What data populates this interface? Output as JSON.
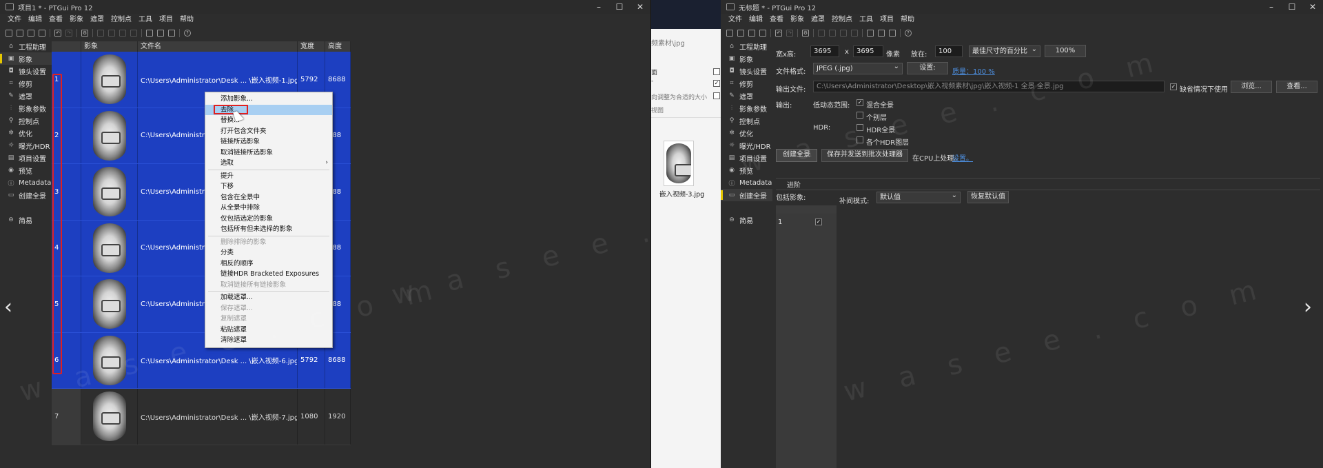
{
  "left_window": {
    "title": "项目1 * - PTGui Pro 12",
    "menu": [
      "文件",
      "编辑",
      "查看",
      "影象",
      "遮罩",
      "控制点",
      "工具",
      "项目",
      "帮助"
    ],
    "sidebar": [
      {
        "label": "工程助理",
        "icon": "home-icon"
      },
      {
        "label": "影象",
        "icon": "image-icon"
      },
      {
        "label": "镜头设置",
        "icon": "camera-icon"
      },
      {
        "label": "修剪",
        "icon": "crop-icon"
      },
      {
        "label": "遮罩",
        "icon": "brush-icon"
      },
      {
        "label": "影象参数",
        "icon": "sliders-icon"
      },
      {
        "label": "控制点",
        "icon": "control-points-icon"
      },
      {
        "label": "优化",
        "icon": "optimize-icon"
      },
      {
        "label": "曝光/HDR",
        "icon": "sun-icon"
      },
      {
        "label": "项目设置",
        "icon": "project-settings-icon"
      },
      {
        "label": "预览",
        "icon": "eye-icon"
      },
      {
        "label": "Metadata",
        "icon": "info-icon"
      },
      {
        "label": "创建全景",
        "icon": "panorama-icon"
      },
      {
        "label": "简易",
        "icon": "simple-icon"
      }
    ],
    "grid": {
      "headers": [
        "",
        "影象",
        "文件名",
        "宽度",
        "高度"
      ],
      "rows": [
        {
          "n": "1",
          "file": "C:\\Users\\Administrator\\Desk ... \\嵌入视频-1.jpg",
          "w": "5792",
          "h": "8688",
          "selected": true
        },
        {
          "n": "2",
          "file": "C:\\Users\\Administrator\\Deskt",
          "w": "",
          "h": "688",
          "selected": true
        },
        {
          "n": "3",
          "file": "C:\\Users\\Administrator\\Deskt",
          "w": "",
          "h": "688",
          "selected": true
        },
        {
          "n": "4",
          "file": "C:\\Users\\Administrator\\Deskt",
          "w": "",
          "h": "688",
          "selected": true
        },
        {
          "n": "5",
          "file": "C:\\Users\\Administrator\\Deskt",
          "w": "",
          "h": "688",
          "selected": true
        },
        {
          "n": "6",
          "file": "C:\\Users\\Administrator\\Desk ... \\嵌入视频-6.jpg",
          "w": "5792",
          "h": "8688",
          "selected": true
        },
        {
          "n": "7",
          "file": "C:\\Users\\Administrator\\Desk ... \\嵌入视频-7.jpg",
          "w": "1080",
          "h": "1920",
          "selected": false
        }
      ]
    },
    "context_menu": [
      {
        "label": "添加影象...",
        "state": "normal"
      },
      {
        "label": "去除",
        "state": "highlight"
      },
      {
        "label": "替换...",
        "state": "normal"
      },
      {
        "label": "打开包含文件夹",
        "state": "normal"
      },
      {
        "label": "链接所选影象",
        "state": "normal"
      },
      {
        "label": "取消链接所选影象",
        "state": "normal"
      },
      {
        "label": "选取",
        "state": "submenu"
      },
      {
        "sep": true
      },
      {
        "label": "提升",
        "state": "normal"
      },
      {
        "label": "下移",
        "state": "normal"
      },
      {
        "label": "包含在全景中",
        "state": "normal"
      },
      {
        "label": "从全景中排除",
        "state": "normal"
      },
      {
        "label": "仅包括选定的影象",
        "state": "normal"
      },
      {
        "label": "包括所有但未选择的影象",
        "state": "normal"
      },
      {
        "sep": true
      },
      {
        "label": "删除排除的影象",
        "state": "disabled"
      },
      {
        "label": "分类",
        "state": "normal"
      },
      {
        "label": "相反的顺序",
        "state": "normal"
      },
      {
        "label": "链接HDR Bracketed Exposures",
        "state": "normal"
      },
      {
        "label": "取消链接所有链接影象",
        "state": "disabled"
      },
      {
        "sep": true
      },
      {
        "label": "加载遮罩...",
        "state": "normal"
      },
      {
        "label": "保存遮罩...",
        "state": "disabled"
      },
      {
        "label": "复制遮罩",
        "state": "disabled"
      },
      {
        "label": "粘贴遮罩",
        "state": "normal"
      },
      {
        "label": "清除遮罩",
        "state": "normal"
      }
    ]
  },
  "middle_explorer": {
    "path_fragment": "频素材\\jpg",
    "item1": "面",
    "item2": "-",
    "item3": "向调整为合适的大小",
    "item4": "视图",
    "file_name": "嵌入视频-3.jpg"
  },
  "right_window": {
    "title": "无标题 * - PTGui Pro 12",
    "menu": [
      "文件",
      "编辑",
      "查看",
      "影象",
      "遮罩",
      "控制点",
      "工具",
      "项目",
      "帮助"
    ],
    "sidebar": [
      {
        "label": "工程助理",
        "icon": "home-icon"
      },
      {
        "label": "影象",
        "icon": "image-icon"
      },
      {
        "label": "镜头设置",
        "icon": "camera-icon"
      },
      {
        "label": "修剪",
        "icon": "crop-icon"
      },
      {
        "label": "遮罩",
        "icon": "brush-icon"
      },
      {
        "label": "影象参数",
        "icon": "sliders-icon"
      },
      {
        "label": "控制点",
        "icon": "control-points-icon"
      },
      {
        "label": "优化",
        "icon": "optimize-icon"
      },
      {
        "label": "曝光/HDR",
        "icon": "sun-icon"
      },
      {
        "label": "项目设置",
        "icon": "project-settings-icon"
      },
      {
        "label": "预览",
        "icon": "eye-icon"
      },
      {
        "label": "Metadata",
        "icon": "info-icon"
      },
      {
        "label": "创建全景",
        "icon": "panorama-icon"
      },
      {
        "label": "简易",
        "icon": "simple-icon"
      }
    ],
    "form": {
      "size_label": "宽x高:",
      "width": "3695",
      "x_sep": "x",
      "height": "3695",
      "px_label": "像素",
      "scale_label": "放在:",
      "scale_value": "100",
      "scale_mode": "最佳尺寸的百分比",
      "percent_button": "100%",
      "format_label": "文件格式:",
      "format_value": "JPEG (.jpg)",
      "settings_button": "设置:",
      "quality_link": "质量：100 %",
      "output_label": "输出文件:",
      "output_path": "C:\\Users\\Administrator\\Desktop\\嵌入视频素材\\jpg\\嵌入视频-1 全景 全景.jpg",
      "default_check_label": "缺省情况下使用",
      "browse_button": "浏览...",
      "view_button": "查看...",
      "output_section": "输出:",
      "ldr_label": "低动态范围:",
      "blend_label": "混合全景",
      "layers_label": "个别层",
      "hdr_label": "HDR:",
      "hdr_pano_label": "HDR全景",
      "hdr_layers_label": "各个HDR图层",
      "create_button": "创建全景",
      "batch_button": "保存并发送到批次处理器",
      "cpu_text": "在CPU上处理。",
      "cpu_settings_link": "设置。",
      "advanced_label": "进阶",
      "include_label": "包括影象:",
      "interp_label": "补间模式:",
      "interp_value": "默认值",
      "reset_button": "恢复默认值",
      "include_row": "1"
    }
  },
  "watermark": "w a s e e . c o m",
  "colors": {
    "selection": "#1d3fc1",
    "highlight_box": "#e02020",
    "accent": "#e6c700",
    "link": "#4d8fe0"
  }
}
